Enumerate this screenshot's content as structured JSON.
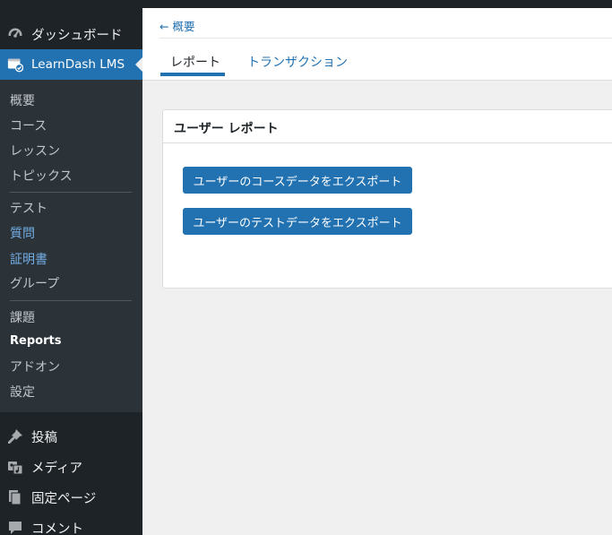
{
  "sidebar": {
    "dashboard": "ダッシュボード",
    "learndash": "LearnDash LMS",
    "submenu": [
      "概要",
      "コース",
      "レッスン",
      "トピックス",
      "テスト",
      "質問",
      "証明書",
      "グループ",
      "課題",
      "Reports",
      "アドオン",
      "設定"
    ],
    "posts": "投稿",
    "media": "メディア",
    "pages": "固定ページ",
    "comments": "コメント"
  },
  "header": {
    "back_link": "← 概要",
    "tabs": [
      "レポート",
      "トランザクション"
    ]
  },
  "card": {
    "title": "ユーザー レポート",
    "buttons": [
      "ユーザーのコースデータをエクスポート",
      "ユーザーのテストデータをエクスポート"
    ]
  },
  "colors": {
    "accent": "#2271b1",
    "sidebar_bg": "#1d2327",
    "submenu_bg": "#2c3338",
    "link_blue": "#72aee6"
  }
}
